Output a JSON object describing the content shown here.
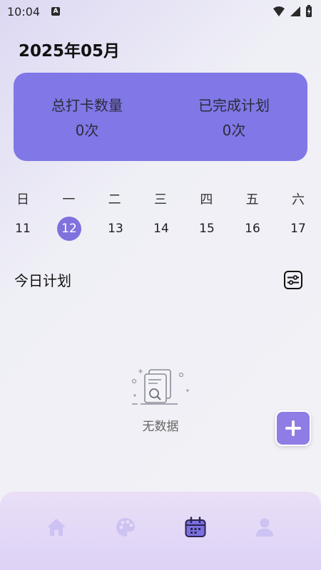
{
  "status_bar": {
    "time": "10:04",
    "a_badge": "A"
  },
  "header": {
    "month": "2025年05月"
  },
  "stats": {
    "checkins_label": "总打卡数量",
    "checkins_value": "0次",
    "completed_label": "已完成计划",
    "completed_value": "0次"
  },
  "calendar": {
    "weekdays": [
      "日",
      "一",
      "二",
      "三",
      "四",
      "五",
      "六"
    ],
    "days": [
      "11",
      "12",
      "13",
      "14",
      "15",
      "16",
      "17"
    ],
    "selected_index": 1
  },
  "plan": {
    "title": "今日计划",
    "empty_text": "无数据"
  },
  "icons": {
    "filter": "filter-icon",
    "fab": "plus-icon",
    "nav_home": "home-icon",
    "nav_palette": "palette-icon",
    "nav_calendar": "calendar-icon",
    "nav_profile": "person-icon"
  },
  "colors": {
    "accent": "#8078e6",
    "selected_day": "#7f72dd",
    "fab": "#8f7ce5",
    "nav_inactive": "#cdc3f2",
    "nav_active": "#7b6fe0"
  }
}
